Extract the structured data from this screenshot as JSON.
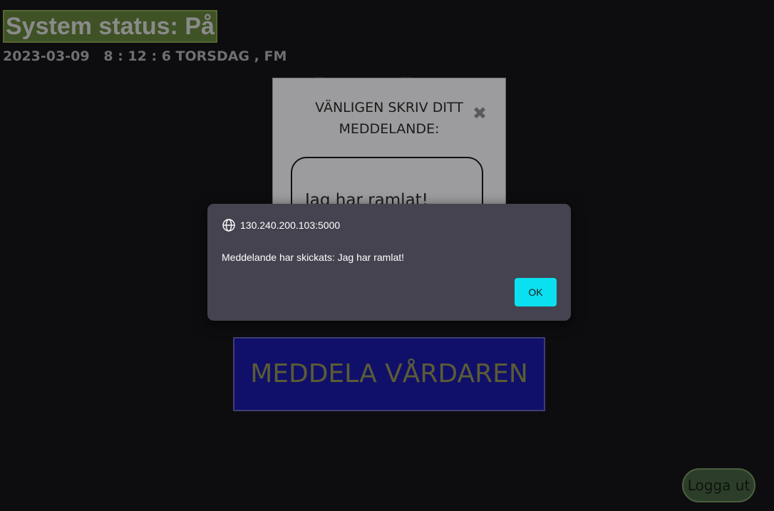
{
  "header": {
    "system_status": "System status: På",
    "datetime": "2023-03-09   8 : 12 : 6 TORSDAG , FM"
  },
  "message_modal": {
    "title": "VÄNLIGEN SKRIV DITT MEDDELANDE:",
    "close_icon": "close-icon",
    "message_value": "Jag har ramlat!"
  },
  "notify_button": {
    "label": "MEDDELA VÅRDAREN"
  },
  "logout_button": {
    "label": "Logga ut"
  },
  "alert_dialog": {
    "origin": "130.240.200.103:5000",
    "origin_icon": "globe-icon",
    "message": "Meddelande har skickats: Jag har ramlat!",
    "ok_label": "OK"
  },
  "colors": {
    "background": "#0d0d10",
    "status_bg": "#3f5225",
    "modal_bg": "#9c9c9e",
    "notify_bg": "#10106a",
    "logout_bg": "#2c3e2a",
    "alert_bg": "#45434f",
    "ok_bg": "#0ae0f0"
  }
}
